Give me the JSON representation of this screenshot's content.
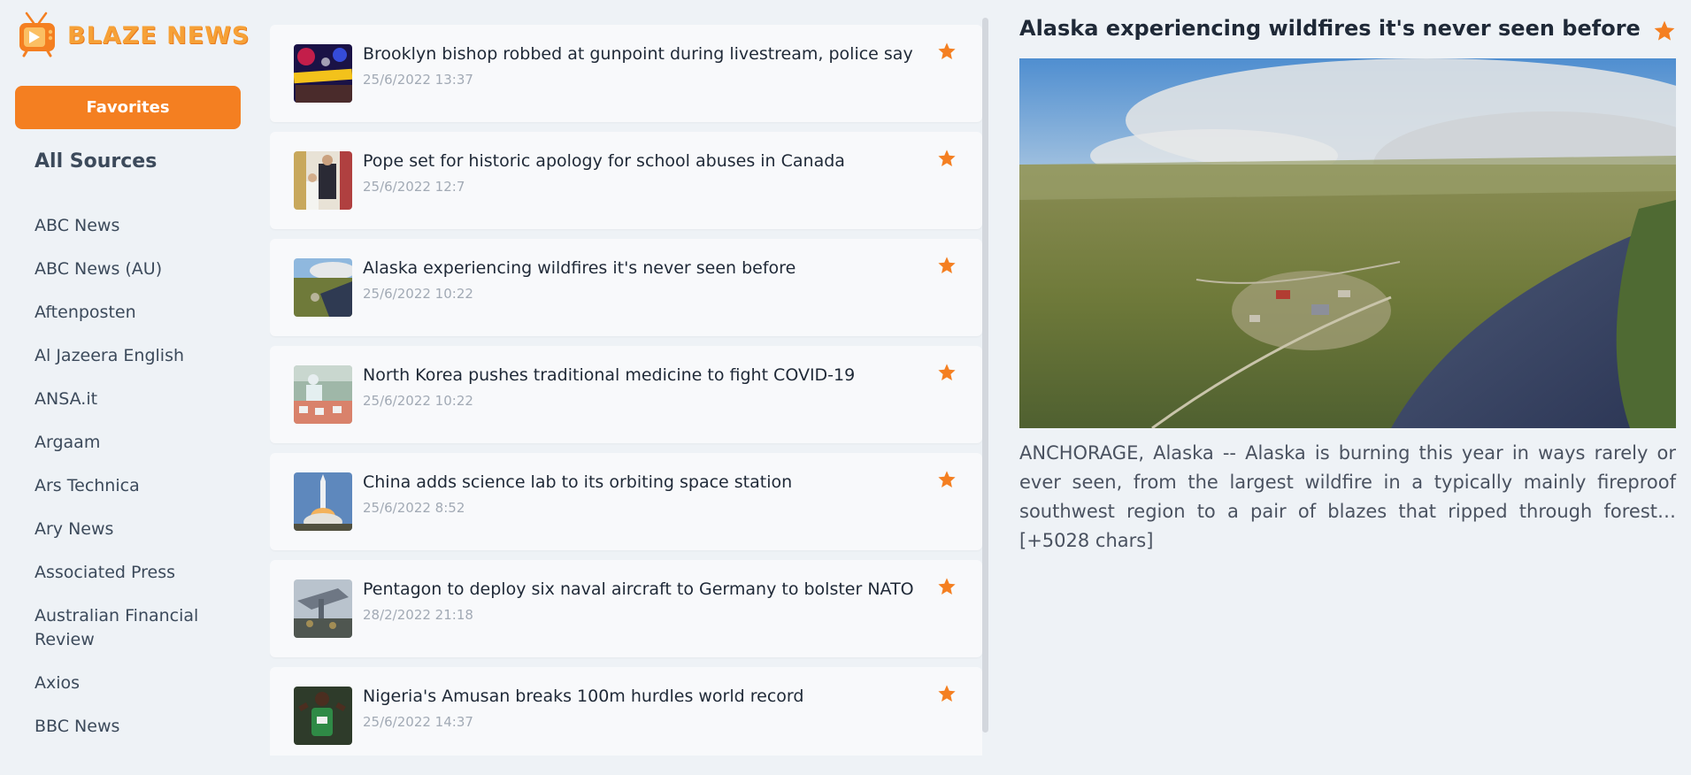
{
  "brand": {
    "name": "BLAZE NEWS"
  },
  "sidebar": {
    "favorites_label": "Favorites",
    "all_sources_label": "All Sources",
    "sources": [
      "ABC News",
      "ABC News (AU)",
      "Aftenposten",
      "Al Jazeera English",
      "ANSA.it",
      "Argaam",
      "Ars Technica",
      "Ary News",
      "Associated Press",
      "Australian Financial Review",
      "Axios",
      "BBC News"
    ]
  },
  "feed": {
    "articles": [
      {
        "title": "Brooklyn bishop robbed at gunpoint during livestream, police say",
        "date": "25/6/2022 13:37",
        "starred": true
      },
      {
        "title": "Pope set for historic apology for school abuses in Canada",
        "date": "25/6/2022 12:7",
        "starred": true
      },
      {
        "title": "Alaska experiencing wildfires it's never seen before",
        "date": "25/6/2022 10:22",
        "starred": true
      },
      {
        "title": "North Korea pushes traditional medicine to fight COVID-19",
        "date": "25/6/2022 10:22",
        "starred": true
      },
      {
        "title": "China adds science lab to its orbiting space station",
        "date": "25/6/2022 8:52",
        "starred": true
      },
      {
        "title": "Pentagon to deploy six naval aircraft to Germany to bolster NATO",
        "date": "28/2/2022 21:18",
        "starred": true
      },
      {
        "title": "Nigeria's Amusan breaks 100m hurdles world record",
        "date": "25/6/2022 14:37",
        "starred": true
      }
    ]
  },
  "detail": {
    "title": "Alaska experiencing wildfires it's never seen before",
    "starred": true,
    "body": "ANCHORAGE, Alaska -- Alaska is burning this year in ways rarely or ever seen, from the largest wildfire in a typically mainly fireproof southwest region to a pair of blazes that ripped through forest… [+5028 chars]"
  },
  "colors": {
    "accent": "#f47f21",
    "background": "#eef2f6",
    "card": "#f8f9fb",
    "date_text": "#a2aab5"
  }
}
